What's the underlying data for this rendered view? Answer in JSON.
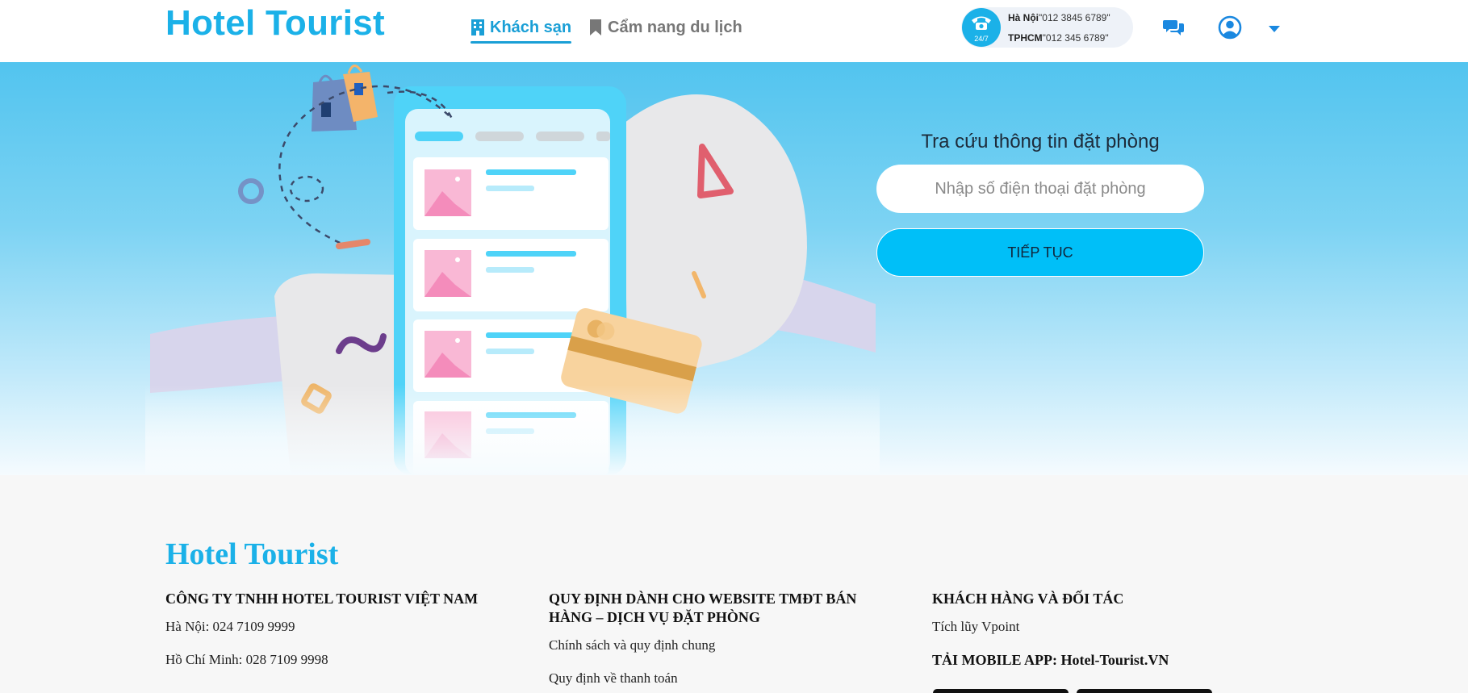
{
  "header": {
    "logo": "Hotel Tourist",
    "nav": [
      {
        "label": "Khách sạn",
        "icon": "building-icon",
        "active": true
      },
      {
        "label": "Cẩm nang du lịch",
        "icon": "bookmark-icon",
        "active": false
      }
    ],
    "hotline": {
      "badge": "24/7",
      "lines": [
        {
          "city": "Hà Nội",
          "number": "\"012 3845 6789\""
        },
        {
          "city": "TPHCM",
          "number": "\"012 345 6789\""
        }
      ]
    },
    "icons": [
      "chat-icon",
      "user-icon",
      "caret-down-icon"
    ]
  },
  "search": {
    "title": "Tra cứu thông tin đặt phòng",
    "placeholder": "Nhập số điện thoại đặt phòng",
    "button": "TIẾP TỤC"
  },
  "footer": {
    "logo": "Hotel Tourist",
    "columns": [
      {
        "heading": "CÔNG TY TNHH HOTEL TOURIST VIỆT NAM",
        "items": [
          "Hà Nội: 024 7109 9999",
          "Hồ Chí Minh: 028 7109 9998"
        ]
      },
      {
        "heading": "QUY ĐỊNH DÀNH CHO WEBSITE TMĐT BÁN HÀNG – DỊCH VỤ ĐẶT PHÒNG",
        "items": [
          "Chính sách và quy định chung",
          "Quy định về thanh toán"
        ]
      },
      {
        "heading": "KHÁCH HÀNG VÀ ĐỐI TÁC",
        "items": [
          "Tích lũy Vpoint"
        ],
        "app_heading": "TẢI MOBILE APP: Hotel-Tourist.VN"
      }
    ]
  },
  "colors": {
    "brand": "#1bb1e8",
    "button": "#00bff8",
    "nav_active": "#1a9fd6"
  }
}
